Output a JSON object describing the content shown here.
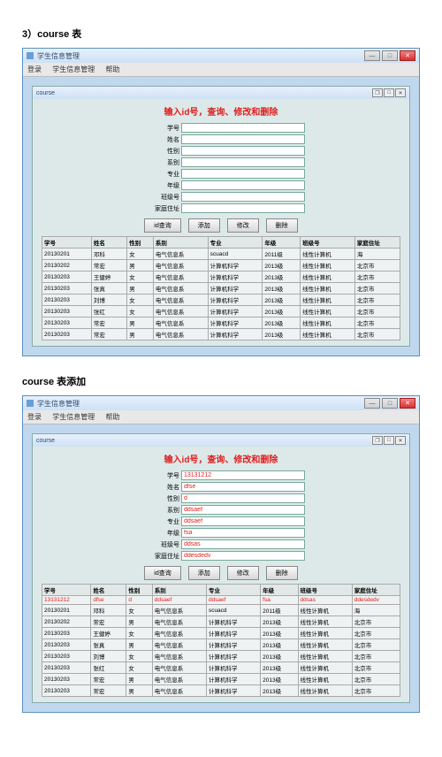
{
  "doc": {
    "heading1": "3）course 表",
    "heading2": "course 表添加"
  },
  "window": {
    "title": "学生信息管理",
    "menu": {
      "item1": "登录",
      "item2": "学生信息管理",
      "item3": "帮助"
    },
    "inner_title": "course"
  },
  "form": {
    "title": "输入id号，查询、修改和删除",
    "labels": {
      "sid": "学号",
      "name": "姓名",
      "gender": "性别",
      "dept": "系别",
      "major": "专业",
      "year": "年级",
      "class": "班级号",
      "hometown": "家庭住址"
    },
    "buttons": {
      "query": "id查询",
      "add": "添加",
      "edit": "修改",
      "delete": "删除"
    }
  },
  "form2": {
    "values": {
      "sid": "13131212",
      "name": "dfse",
      "gender": "d",
      "dept": "ddsaef",
      "major": "ddsaef",
      "year": "fsa",
      "class": "ddsas",
      "hometown": "ddesdedv"
    }
  },
  "table": {
    "headers": {
      "sid": "学号",
      "name": "姓名",
      "gender": "性别",
      "dept": "系别",
      "major": "专业",
      "year": "年级",
      "class": "班级号",
      "hometown": "家庭住址"
    },
    "rows": [
      {
        "sid": "20130201",
        "name": "邓科",
        "gender": "女",
        "dept": "电气信息系",
        "major": "scuacd",
        "year": "2011级",
        "class": "线性计算机",
        "hometown": "海"
      },
      {
        "sid": "20130202",
        "name": "常宏",
        "gender": "男",
        "dept": "电气信息系",
        "major": "计算机科学",
        "year": "2013级",
        "class": "线性计算机",
        "hometown": "北京市"
      },
      {
        "sid": "20130203",
        "name": "王健婷",
        "gender": "女",
        "dept": "电气信息系",
        "major": "计算机科学",
        "year": "2013级",
        "class": "线性计算机",
        "hometown": "北京市"
      },
      {
        "sid": "20130203",
        "name": "张真",
        "gender": "男",
        "dept": "电气信息系",
        "major": "计算机科学",
        "year": "2013级",
        "class": "线性计算机",
        "hometown": "北京市"
      },
      {
        "sid": "20130203",
        "name": "刘博",
        "gender": "女",
        "dept": "电气信息系",
        "major": "计算机科学",
        "year": "2013级",
        "class": "线性计算机",
        "hometown": "北京市"
      },
      {
        "sid": "20130203",
        "name": "张红",
        "gender": "女",
        "dept": "电气信息系",
        "major": "计算机科学",
        "year": "2013级",
        "class": "线性计算机",
        "hometown": "北京市"
      },
      {
        "sid": "20130203",
        "name": "常宏",
        "gender": "男",
        "dept": "电气信息系",
        "major": "计算机科学",
        "year": "2013级",
        "class": "线性计算机",
        "hometown": "北京市"
      },
      {
        "sid": "20130203",
        "name": "常宏",
        "gender": "男",
        "dept": "电气信息系",
        "major": "计算机科学",
        "year": "2013级",
        "class": "线性计算机",
        "hometown": "北京市"
      }
    ],
    "rows2_first": {
      "sid": "13131212",
      "name": "dfse",
      "gender": "d",
      "dept": "ddsaef",
      "major": "ddsaef",
      "year": "fsa",
      "class": "ddsas",
      "hometown": "ddesdedv"
    }
  }
}
